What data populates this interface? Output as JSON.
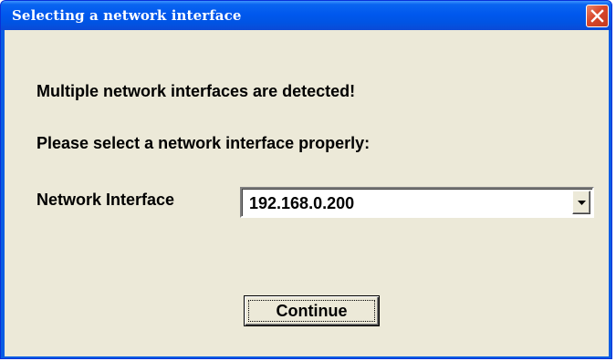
{
  "window": {
    "title": "Selecting a network interface",
    "close_icon": "close-icon"
  },
  "dialog": {
    "message_detected": "Multiple network interfaces are detected!",
    "message_select": "Please select a network interface properly:",
    "interface_label": "Network Interface",
    "interface_selected": "192.168.0.200",
    "dropdown_icon": "chevron-down-icon",
    "continue_label": "Continue"
  },
  "colors": {
    "titlebar": "#0054e3",
    "client_background": "#ece9d8",
    "close_button": "#d9462a"
  }
}
